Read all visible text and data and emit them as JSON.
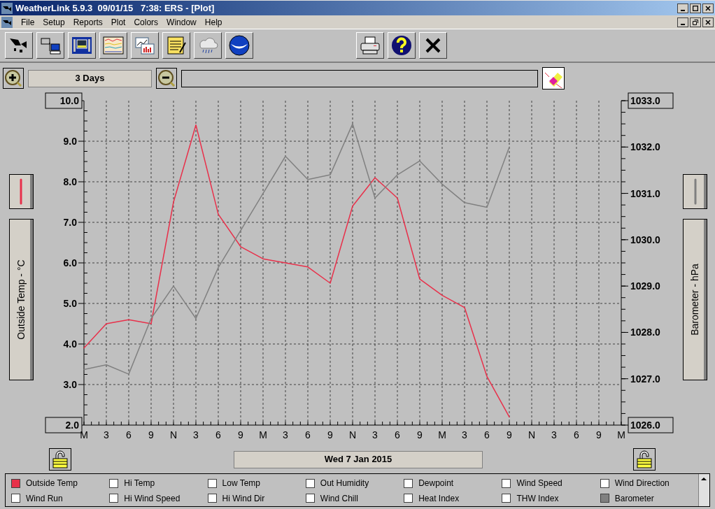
{
  "window": {
    "title": "WeatherLink 5.9.3  09/01/15   7:38: ERS - [Plot]"
  },
  "menu": [
    "File",
    "Setup",
    "Reports",
    "Plot",
    "Colors",
    "Window",
    "Help"
  ],
  "range": {
    "label": "3 Days"
  },
  "left_axis": {
    "label": "Outside Temp - °C"
  },
  "right_axis": {
    "label": "Barometer - hPa"
  },
  "chart_data": {
    "type": "line",
    "grid": true,
    "categories": [
      "M",
      "3",
      "6",
      "9",
      "N",
      "3",
      "6",
      "9",
      "M",
      "3",
      "6",
      "9",
      "N",
      "3",
      "6",
      "9",
      "M",
      "3",
      "6",
      "9",
      "N",
      "3",
      "6",
      "9",
      "M"
    ],
    "ylim": [
      2,
      10
    ],
    "yticks": [
      {
        "value": 2,
        "label": "2.0"
      },
      {
        "value": 3,
        "label": "3.0"
      },
      {
        "value": 4,
        "label": "4.0"
      },
      {
        "value": 5,
        "label": "5.0"
      },
      {
        "value": 6,
        "label": "6.0"
      },
      {
        "value": 7,
        "label": "7.0"
      },
      {
        "value": 8,
        "label": "8.0"
      },
      {
        "value": 9,
        "label": "9.0"
      },
      {
        "value": 10,
        "label": "10.0"
      }
    ],
    "y2lim": [
      1026,
      1033
    ],
    "y2ticks": [
      {
        "value": 1026,
        "label": "1026.0"
      },
      {
        "value": 1027,
        "label": "1027.0"
      },
      {
        "value": 1028,
        "label": "1028.0"
      },
      {
        "value": 1029,
        "label": "1029.0"
      },
      {
        "value": 1030,
        "label": "1030.0"
      },
      {
        "value": 1031,
        "label": "1031.0"
      },
      {
        "value": 1032,
        "label": "1032.0"
      },
      {
        "value": 1033,
        "label": "1033.0"
      }
    ],
    "series": [
      {
        "name": "Outside Temp",
        "color": "#e8304a",
        "values": [
          3.9,
          4.5,
          4.6,
          4.5,
          7.5,
          9.4,
          7.2,
          6.4,
          6.1,
          6.0,
          5.9,
          5.5,
          7.4,
          8.1,
          7.6,
          5.6,
          5.2,
          4.9,
          3.2,
          2.2,
          null,
          null,
          null,
          null,
          null
        ]
      },
      {
        "name": "Barometer",
        "color": "#808080",
        "axis": "y2",
        "values": [
          1027.2,
          1027.3,
          1027.1,
          1028.3,
          1029.0,
          1028.3,
          1029.4,
          1030.2,
          1031.0,
          1031.8,
          1031.3,
          1031.4,
          1032.5,
          1030.9,
          1031.4,
          1031.7,
          1031.2,
          1030.8,
          1030.7,
          1032.0,
          null,
          null,
          null,
          null,
          null
        ]
      }
    ]
  },
  "date": {
    "label": "Wed 7 Jan 2015"
  },
  "legend": [
    {
      "kind": "series",
      "checked": true
    },
    {
      "label": "Hi Temp",
      "checked": false
    },
    {
      "label": "Low Temp",
      "checked": false
    },
    {
      "label": "Out Humidity",
      "checked": false
    },
    {
      "label": "Dewpoint",
      "checked": false
    },
    {
      "label": "Wind Speed",
      "checked": false
    },
    {
      "label": "Wind Direction",
      "checked": false
    },
    {
      "label": "Wind Run",
      "checked": false
    },
    {
      "label": "Hi Wind Speed",
      "checked": false
    },
    {
      "label": "Hi Wind Dir",
      "checked": false
    },
    {
      "label": "Wind Chill",
      "checked": false
    },
    {
      "label": "Heat Index",
      "checked": false
    },
    {
      "label": "THW Index",
      "checked": false
    },
    {
      "kind": "series",
      "checked": true
    }
  ]
}
